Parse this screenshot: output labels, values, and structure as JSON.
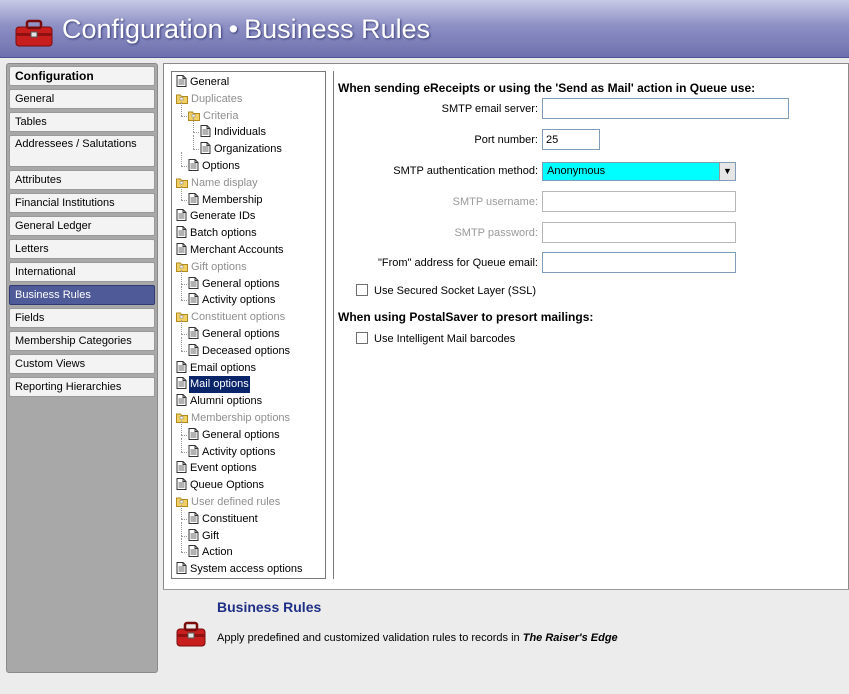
{
  "window": {
    "title_part1": "Configuration",
    "title_sep": "•",
    "title_part2": "Business Rules"
  },
  "colors": {
    "title_bar": "#7f82bd",
    "nav_active": "#4f5b98",
    "selected_tree": "#0a246a",
    "combo_highlight": "#00ffff",
    "info_title": "#1f2f86"
  },
  "sidebar": {
    "header": "Configuration",
    "items": [
      {
        "label": "General"
      },
      {
        "label": "Tables"
      },
      {
        "label": "Addressees / Salutations"
      },
      {
        "label": "Attributes"
      },
      {
        "label": "Financial Institutions"
      },
      {
        "label": "General Ledger"
      },
      {
        "label": "Letters"
      },
      {
        "label": "International"
      },
      {
        "label": "Business Rules",
        "active": true
      },
      {
        "label": "Fields"
      },
      {
        "label": "Membership Categories"
      },
      {
        "label": "Custom Views"
      },
      {
        "label": "Reporting Hierarchies"
      }
    ]
  },
  "tree": {
    "nodes": [
      {
        "label": "General",
        "icon": "page-icon"
      },
      {
        "label": "Duplicates",
        "icon": "folder-icon",
        "disabled": true
      },
      {
        "label": "Criteria",
        "icon": "folder-icon",
        "disabled": true
      },
      {
        "label": "Individuals",
        "icon": "page-icon"
      },
      {
        "label": "Organizations",
        "icon": "page-icon"
      },
      {
        "label": "Options",
        "icon": "page-icon"
      },
      {
        "label": "Name display",
        "icon": "folder-icon",
        "disabled": true
      },
      {
        "label": "Membership",
        "icon": "page-icon"
      },
      {
        "label": "Generate IDs",
        "icon": "page-icon"
      },
      {
        "label": "Batch options",
        "icon": "page-icon"
      },
      {
        "label": "Merchant Accounts",
        "icon": "page-icon"
      },
      {
        "label": "Gift options",
        "icon": "folder-icon",
        "disabled": true
      },
      {
        "label": "General options",
        "icon": "page-icon"
      },
      {
        "label": "Activity options",
        "icon": "page-icon"
      },
      {
        "label": "Constituent options",
        "icon": "folder-icon",
        "disabled": true
      },
      {
        "label": "General options",
        "icon": "page-icon"
      },
      {
        "label": "Deceased options",
        "icon": "page-icon"
      },
      {
        "label": "Email options",
        "icon": "page-icon"
      },
      {
        "label": "Mail options",
        "icon": "page-icon",
        "selected": true
      },
      {
        "label": "Alumni options",
        "icon": "page-icon"
      },
      {
        "label": "Membership options",
        "icon": "folder-icon",
        "disabled": true
      },
      {
        "label": "General options",
        "icon": "page-icon"
      },
      {
        "label": "Activity options",
        "icon": "page-icon"
      },
      {
        "label": "Event options",
        "icon": "page-icon"
      },
      {
        "label": "Queue Options",
        "icon": "page-icon"
      },
      {
        "label": "User defined rules",
        "icon": "folder-icon",
        "disabled": true
      },
      {
        "label": "Constituent",
        "icon": "page-icon"
      },
      {
        "label": "Gift",
        "icon": "page-icon"
      },
      {
        "label": "Action",
        "icon": "page-icon"
      },
      {
        "label": "System access options",
        "icon": "page-icon"
      }
    ]
  },
  "form": {
    "section1_title": "When sending eReceipts or using the 'Send as Mail' action in Queue use:",
    "smtp_server": {
      "label": "SMTP email server:",
      "value": ""
    },
    "port": {
      "label": "Port number:",
      "value": "25"
    },
    "auth_method": {
      "label": "SMTP authentication method:",
      "value": "Anonymous"
    },
    "smtp_username": {
      "label": "SMTP username:",
      "value": ""
    },
    "smtp_password": {
      "label": "SMTP password:",
      "value": ""
    },
    "from_address": {
      "label": "\"From\" address for Queue email:",
      "value": ""
    },
    "ssl": {
      "label": "Use Secured Socket Layer (SSL)",
      "checked": false
    },
    "section2_title": "When using PostalSaver to presort mailings:",
    "intelligent_mail": {
      "label": "Use Intelligent Mail barcodes",
      "checked": false
    }
  },
  "info": {
    "title": "Business Rules",
    "desc_prefix": "Apply predefined and customized validation rules to records in",
    "desc_product": "The Raiser's Edge"
  }
}
